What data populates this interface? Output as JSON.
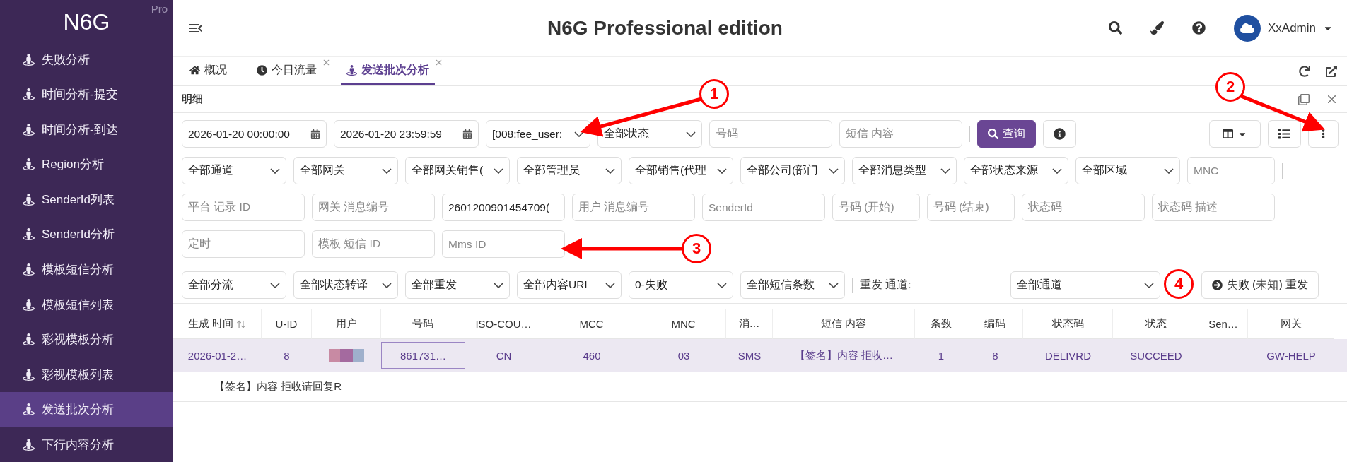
{
  "sidebar": {
    "logo": "N6G",
    "badge": "Pro",
    "items": [
      {
        "label": "失败分析",
        "selected": false
      },
      {
        "label": "时间分析-提交",
        "selected": false
      },
      {
        "label": "时间分析-到达",
        "selected": false
      },
      {
        "label": "Region分析",
        "selected": false
      },
      {
        "label": "SenderId列表",
        "selected": false
      },
      {
        "label": "SenderId分析",
        "selected": false
      },
      {
        "label": "模板短信分析",
        "selected": false
      },
      {
        "label": "模板短信列表",
        "selected": false
      },
      {
        "label": "彩视模板分析",
        "selected": false
      },
      {
        "label": "彩视模板列表",
        "selected": false
      },
      {
        "label": "发送批次分析",
        "selected": true
      },
      {
        "label": "下行内容分析",
        "selected": false
      }
    ]
  },
  "header": {
    "title": "N6G Professional edition",
    "user": "XxAdmin"
  },
  "tabs": [
    {
      "label": "概况",
      "closable": false,
      "selected": false
    },
    {
      "label": "今日流量",
      "closable": true,
      "selected": false
    },
    {
      "label": "发送批次分析",
      "closable": true,
      "selected": true
    }
  ],
  "panel": {
    "title": "明细"
  },
  "filters": [
    [
      {
        "kind": "date",
        "value": "2026-01-20 00:00:00"
      },
      {
        "kind": "date",
        "value": "2026-01-20 23:59:59"
      },
      {
        "kind": "select",
        "value": "[008:fee_user:"
      },
      {
        "kind": "select",
        "value": "全部状态"
      },
      {
        "kind": "input",
        "placeholder": "号码"
      },
      {
        "kind": "input",
        "placeholder": "短信 内容"
      }
    ],
    [
      {
        "kind": "select",
        "value": "全部通道"
      },
      {
        "kind": "select",
        "value": "全部网关"
      },
      {
        "kind": "select",
        "value": "全部网关销售("
      },
      {
        "kind": "select",
        "value": "全部管理员"
      },
      {
        "kind": "select",
        "value": "全部销售(代理"
      },
      {
        "kind": "select",
        "value": "全部公司(部门"
      },
      {
        "kind": "select",
        "value": "全部消息类型"
      },
      {
        "kind": "select",
        "value": "全部状态来源"
      },
      {
        "kind": "select",
        "value": "全部区域"
      },
      {
        "kind": "narrow",
        "placeholder": "MNC"
      }
    ],
    [
      {
        "kind": "input",
        "placeholder": "平台 记录 ID"
      },
      {
        "kind": "input",
        "placeholder": "网关 消息编号"
      },
      {
        "kind": "input",
        "value": "2601200901454709("
      },
      {
        "kind": "input",
        "placeholder": "用户 消息编号"
      },
      {
        "kind": "input",
        "placeholder": "SenderId"
      },
      {
        "kind": "narrow",
        "placeholder": "号码 (开始)"
      },
      {
        "kind": "narrow",
        "placeholder": "号码 (结束)"
      },
      {
        "kind": "input",
        "placeholder": "状态码"
      },
      {
        "kind": "input",
        "placeholder": "状态码 描述"
      }
    ],
    [
      {
        "kind": "input",
        "placeholder": "定时"
      },
      {
        "kind": "input",
        "placeholder": "模板 短信 ID"
      },
      {
        "kind": "input",
        "placeholder": "Mms ID"
      }
    ],
    [
      {
        "kind": "select",
        "value": "全部分流"
      },
      {
        "kind": "select",
        "value": "全部状态转译"
      },
      {
        "kind": "select",
        "value": "全部重发"
      },
      {
        "kind": "select",
        "value": "全部内容URL"
      },
      {
        "kind": "select",
        "value": "0-失败"
      },
      {
        "kind": "select",
        "value": "全部短信条数"
      }
    ]
  ],
  "query_button": "查询",
  "resend": {
    "label": "重发 通道:",
    "channel": "全部通道",
    "button": "失败 (未知) 重发"
  },
  "table": {
    "columns": [
      "生成 时间",
      "U-ID",
      "用户",
      "号码",
      "ISO-COU…",
      "MCC",
      "MNC",
      "消…",
      "短信 内容",
      "条数",
      "编码",
      "状态码",
      "状态",
      "Sen…",
      "网关"
    ],
    "rows": [
      {
        "selected": true,
        "cells": [
          "2026-01-2…",
          "8",
          "",
          "861731…",
          "CN",
          "460",
          "03",
          "SMS",
          "【签名】内容 拒收…",
          "1",
          "8",
          "DELIVRD",
          "SUCCEED",
          "",
          "GW-HELP"
        ]
      }
    ],
    "detail": "【签名】内容 拒收请回复R"
  },
  "annotations": [
    "1",
    "2",
    "3",
    "4"
  ]
}
